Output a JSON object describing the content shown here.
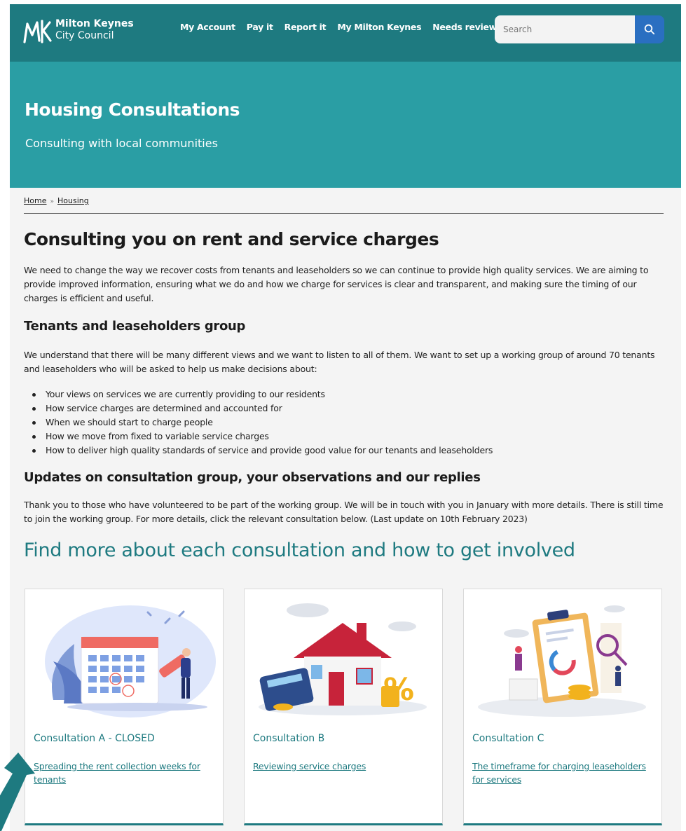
{
  "header": {
    "logo_line1": "Milton Keynes",
    "logo_line2": "City Council",
    "logo_icon": "mk-logo-icon",
    "nav": [
      "My Account",
      "Pay it",
      "Report it",
      "My Milton Keynes",
      "Needs review"
    ],
    "search_placeholder": "Search",
    "search_icon": "search-icon"
  },
  "hero": {
    "title": "Housing Consultations",
    "subtitle": "Consulting with local communities"
  },
  "breadcrumb": [
    "Home",
    "Housing"
  ],
  "main": {
    "title": "Consulting you on rent and service charges",
    "intro": "We need to change the way we recover costs from tenants and leaseholders so we can continue to provide high quality services. We are aiming to provide improved information, ensuring what we do and how we charge for services is clear and transparent, and making sure the timing of our charges is efficient and useful.",
    "group_heading": "Tenants and leaseholders group",
    "group_text": "We understand that there will be many different views and we want to listen to all of them. We want to set up a working group of around 70 tenants and leaseholders who will be asked to help us make decisions about:",
    "bullets": [
      "Your views on services we are currently providing to our residents",
      "How service charges are determined and accounted for",
      "When we should start to charge people",
      "How we move from fixed to variable service charges",
      "How to deliver high quality standards of service and provide good value for our tenants and leaseholders"
    ],
    "updates_heading": "Updates on consultation group, your observations and our replies",
    "updates_text": "Thank you to those who have volunteered to be part of the working group.  We will be in touch with you in January with more details. There is still time to join the working group. For more details, click the relevant consultation below. (Last update on 10th February 2023)",
    "find_heading": "Find more about each consultation and how to get involved"
  },
  "cards": [
    {
      "title": "Consultation A - CLOSED",
      "link": "Spreading the rent collection weeks for tenants",
      "image": "calendar-illustration"
    },
    {
      "title": "Consultation B",
      "link": "Reviewing service charges",
      "image": "house-illustration"
    },
    {
      "title": "Consultation C",
      "link": "The timeframe for charging leaseholders for services",
      "image": "clipboard-illustration"
    }
  ],
  "colors": {
    "header": "#1e7a80",
    "hero": "#2a9ea4",
    "search_button": "#2a6fc1",
    "page_bg": "#f4f4f4"
  }
}
